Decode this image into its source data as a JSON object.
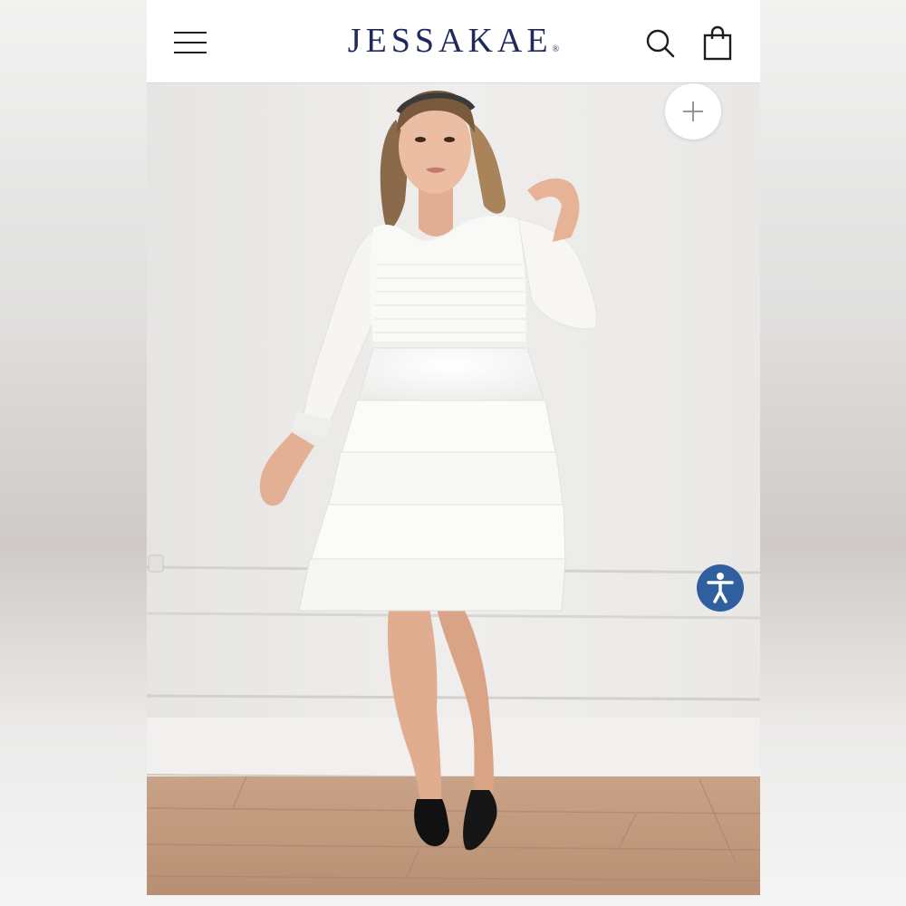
{
  "header": {
    "brand_name": "JESSAKAE",
    "brand_mark": "®",
    "menu_icon": "hamburger-menu-icon",
    "search_icon": "search-icon",
    "cart_icon": "shopping-bag-icon"
  },
  "hero": {
    "image_subject": "model-in-white-tiered-tulle-dress",
    "zoom_icon": "plus-icon",
    "accessibility_icon": "accessibility-icon"
  },
  "colors": {
    "brand": "#1f2a5b",
    "accessibility_button": "#2f5f9e",
    "wall": "#ecebea",
    "floor": "#c49a7e"
  }
}
